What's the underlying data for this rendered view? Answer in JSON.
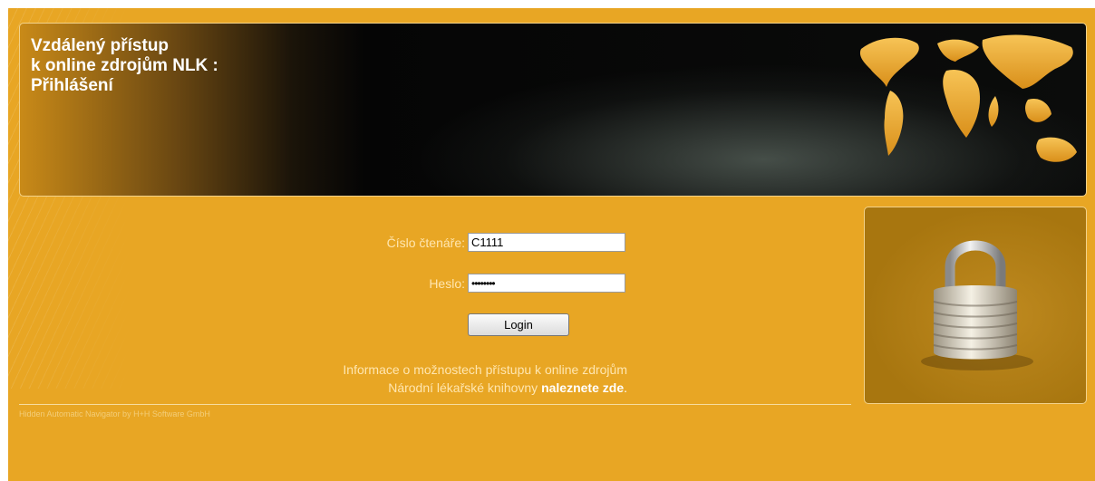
{
  "banner": {
    "title_lines": [
      "Vzdálený přístup",
      "k online zdrojům NLK :",
      "Přihlášení"
    ]
  },
  "login": {
    "reader_label": "Číslo čtenáře:",
    "reader_value": "C1111",
    "password_label": "Heslo:",
    "password_value": "••••••••",
    "login_button": "Login"
  },
  "info": {
    "line1": "Informace o možnostech přístupu k online zdrojům",
    "line2_prefix": "Národní lékařské knihovny ",
    "link_text": "naleznete zde",
    "line2_suffix": "."
  },
  "footer": {
    "credit": "Hidden Automatic Navigator by H+H Software GmbH"
  },
  "icons": {
    "banner_image": "world-map-icon",
    "side_image": "padlock-icon"
  },
  "colors": {
    "background": "#e8a624",
    "banner_dark": "#050505",
    "label_text": "#ffe6b0",
    "map_gold": "#f2b43c"
  }
}
